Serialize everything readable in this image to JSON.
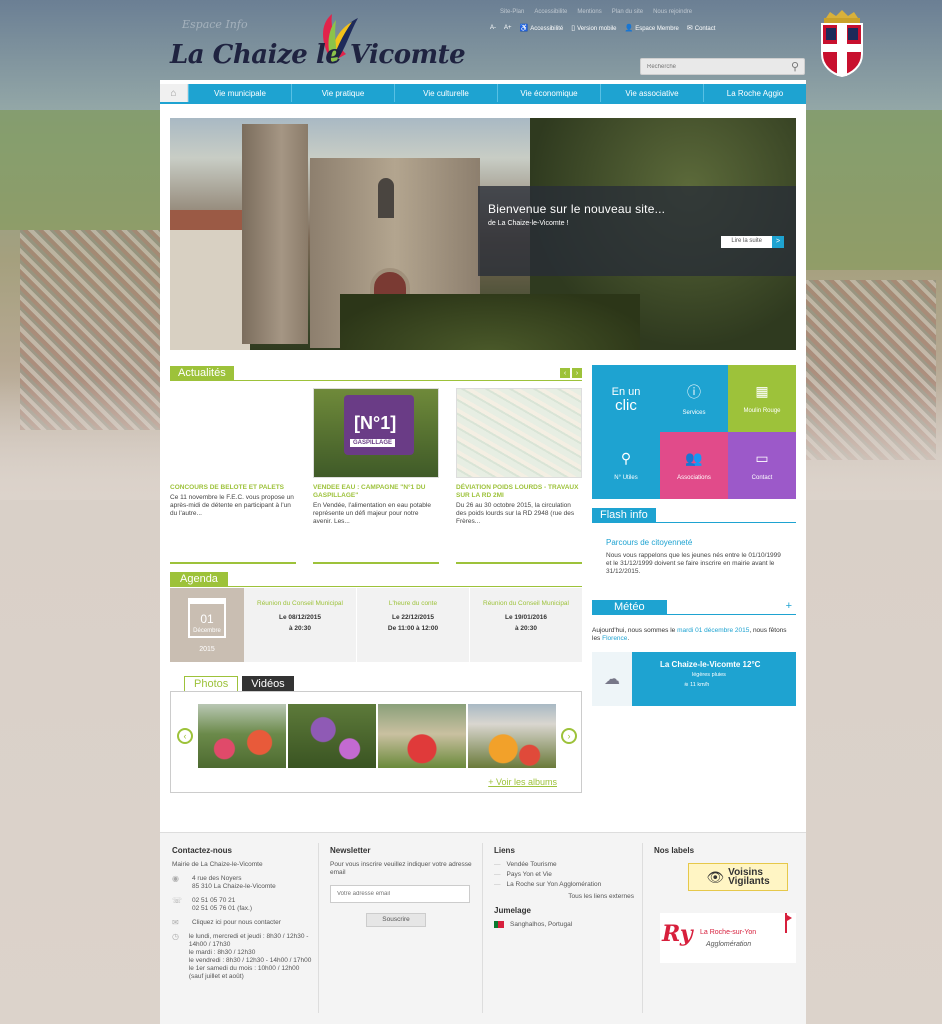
{
  "search": {
    "placeholder": "Recherche"
  },
  "toplinks": {
    "faded": [
      "Site-Plan",
      "Accessibilite",
      "Mentions",
      "Plan du site",
      "Nous rejoindre"
    ],
    "links": [
      "A-",
      "A+",
      "Accessibilité",
      "Version mobile",
      "Espace Membre",
      "Contact"
    ]
  },
  "header": {
    "ghost": "Espace Info",
    "logo_text": "La Chaize le Vicomte"
  },
  "nav": {
    "items": [
      "Vie municipale",
      "Vie pratique",
      "Vie culturelle",
      "Vie économique",
      "Vie associative",
      "La Roche Aggio"
    ]
  },
  "slider": {
    "title": "Bienvenue sur le nouveau site...",
    "subtitle": "de La Chaize-le-Vicomte !",
    "button": "Lire la suite"
  },
  "news": {
    "heading": "Actualités",
    "items": [
      {
        "title": "CONCOURS DE BELOTE ET PALETS",
        "desc": "Ce 11 novembre le F.E.C. vous propose un après-midi de détente en participant à l'un du l'autre..."
      },
      {
        "title": "VENDEE EAU : CAMPAGNE \"N°1 DU GASPILLAGE\"",
        "desc": "En Vendée, l'alimentation en eau potable représente un défi majeur pour notre avenir. Les..."
      },
      {
        "title": "DÉVIATION POIDS LOURDS - TRAVAUX SUR LA RD 2MI",
        "desc": "Du 26 au 30 octobre 2015, la circulation des poids lourds sur la RD 2948 (rue des Frères..."
      }
    ],
    "poster_n": "[N°1]",
    "poster_g": "GASPILLAGE"
  },
  "clic": {
    "en": "En un",
    "clic": "clic",
    "tiles": [
      "Services",
      "Moulin Rouge",
      "N° Utiles",
      "Associations",
      "Contact"
    ]
  },
  "flash": {
    "heading": "Flash info",
    "title": "Parcours de citoyenneté",
    "text": "Nous vous rappelons que les jeunes nés entre le 01/10/1999 et le 31/12/1999 doivent se faire inscrire en mairie avant le 31/12/2015."
  },
  "meteo": {
    "heading": "Météo",
    "plus": "+",
    "text1": "Aujourd'hui, nous sommes le ",
    "date": "mardi 01 décembre 2015",
    "text2": ", nous fêtons les ",
    "saint": "Florence",
    "text3": ".",
    "city": "La Chaize-le-Vicomte 12°C",
    "cond": "légères pluies",
    "wind": "11 km/h"
  },
  "agenda": {
    "heading": "Agenda",
    "cal_day": "01",
    "cal_month": "Décembre",
    "cal_year": "2015",
    "events": [
      {
        "title": "Réunion du Conseil Municipal",
        "date": "Le 08/12/2015",
        "hour": "à 20:30"
      },
      {
        "title": "L'heure du conte",
        "date": "Le 22/12/2015",
        "hour": "De 11:00 à 12:00"
      },
      {
        "title": "Réunion du Conseil Municipal",
        "date": "Le 19/01/2016",
        "hour": "à 20:30"
      }
    ]
  },
  "media": {
    "tab_photos": "Photos",
    "tab_videos": "Vidéos",
    "more": "+ Voir les albums"
  },
  "footer": {
    "contact": {
      "heading": "Contactez-nous",
      "name": "Mairie de La Chaize-le-Vicomte",
      "addr1": "4 rue des Noyers",
      "addr2": "85 310 La Chaize-le-Vicomte",
      "tel": "02 51 05 70 21",
      "fax": "02 51 05 76 01 (fax.)",
      "click": "Cliquez ici pour nous contacter",
      "hours1": "le lundi, mercredi et jeudi : 8h30 / 12h30 - 14h00 / 17h30",
      "hours2": "le mardi : 8h30 / 12h30",
      "hours3": "le vendredi : 8h30 / 12h30 - 14h00 / 17h00",
      "hours4": "le 1er samedi du mois : 10h00 / 12h00 (sauf juillet et août)"
    },
    "newsletter": {
      "heading": "Newsletter",
      "text": "Pour vous inscrire veuillez indiquer votre adresse email",
      "placeholder": "Votre adresse email",
      "button": "Souscrire"
    },
    "liens": {
      "heading": "Liens",
      "items": [
        "Vendée Tourisme",
        "Pays Yon et Vie",
        "La Roche sur Yon Agglomération"
      ],
      "all": "Tous les liens externes",
      "jumelage": "Jumelage",
      "jumelage_item": "Sanghalhos, Portugal"
    },
    "labels": {
      "heading": "Nos labels",
      "vv1": "Voisins",
      "vv2": "Vigilants",
      "ry_logo": "Ry",
      "ry_name": "La Roche-sur-Yon",
      "ry_sub": "Agglomération"
    }
  }
}
